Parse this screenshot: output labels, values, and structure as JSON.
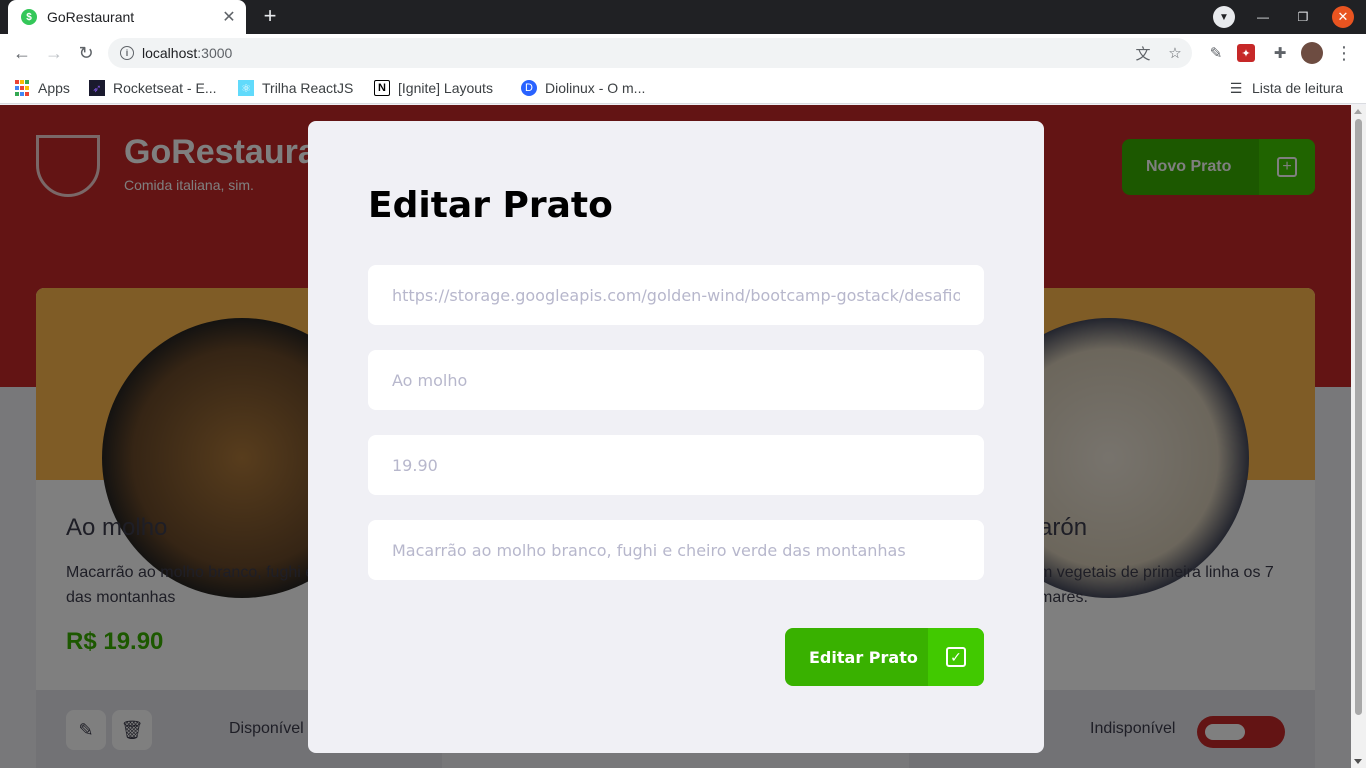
{
  "browser": {
    "tab_title": "GoRestaurant",
    "favicon_glyph": "$",
    "new_tab": "+",
    "url_host": "localhost",
    "url_port": ":3000",
    "bookmarks": [
      {
        "label": "Apps",
        "icon": "apps-grid-icon"
      },
      {
        "label": "Rocketseat - E...",
        "icon": "rocketseat-icon"
      },
      {
        "label": "Trilha ReactJS",
        "icon": "react-icon"
      },
      {
        "label": "[Ignite] Layouts",
        "icon": "notion-icon"
      },
      {
        "label": "Diolinux - O m...",
        "icon": "diolinux-icon"
      }
    ],
    "reading_list": "Lista de leitura"
  },
  "header": {
    "title": "GoRestaurant",
    "subtitle": "Comida italiana, sim.",
    "new_button_label": "Novo Prato"
  },
  "cards": [
    {
      "title": "Ao molho",
      "description": "Macarrão ao molho branco, fughi e cheiro verde das montanhas",
      "price": "R$ 19.90",
      "availability": "Disponível"
    },
    {
      "title_visible": "arón",
      "description_visible": "m vegetais de primeira linha os 7 mares.",
      "availability": "Indisponível"
    }
  ],
  "modal": {
    "title": "Editar Prato",
    "fields": {
      "image_url": "https://storage.googleapis.com/golden-wind/bootcamp-gostack/desafio-gorestaurant-images/ao_molho.png",
      "name": "Ao molho",
      "price": "19.90",
      "description": "Macarrão ao molho branco, fughi e cheiro verde das montanhas"
    },
    "submit_label": "Editar Prato"
  },
  "colors": {
    "primary_red": "#c72828",
    "green": "#39b100",
    "green_light": "#41c900",
    "modal_bg": "#f0f0f5",
    "placeholder": "#b7b7cc"
  }
}
